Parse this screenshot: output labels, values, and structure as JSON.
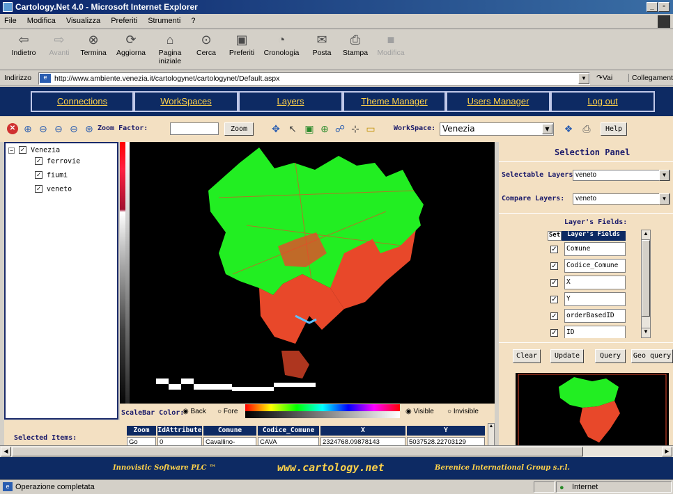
{
  "window": {
    "title": "Cartology.Net 4.0 - Microsoft Internet Explorer"
  },
  "menu": [
    "File",
    "Modifica",
    "Visualizza",
    "Preferiti",
    "Strumenti",
    "?"
  ],
  "toolbar": {
    "back": "Indietro",
    "forward": "Avanti",
    "stop": "Termina",
    "refresh": "Aggiorna",
    "home_line1": "Pagina",
    "home_line2": "iniziale",
    "search": "Cerca",
    "favorites": "Preferiti",
    "history": "Cronologia",
    "mail": "Posta",
    "print": "Stampa",
    "edit": "Modifica"
  },
  "address": {
    "label": "Indirizzo",
    "url": "http://www.ambiente.venezia.it/cartologynet/cartologynet/Default.aspx",
    "go": "Vai",
    "links": "Collegamenti"
  },
  "nav": [
    "Connections",
    "WorkSpaces",
    "Layers",
    "Theme Manager",
    "Users Manager",
    "Log out"
  ],
  "tools": {
    "zoom_factor_label": "Zoom Factor:",
    "zoom_factor_value": "",
    "zoom_button": "Zoom",
    "workspace_label": "WorkSpace:",
    "workspace_value": "Venezia",
    "help_button": "Help"
  },
  "tree": {
    "root": "Venezia",
    "layers": [
      "ferrovie",
      "fiumi",
      "veneto"
    ]
  },
  "selection_panel": {
    "title": "Selection Panel",
    "selectable_label": "Selectable Layers:",
    "selectable_value": "veneto",
    "compare_label": "Compare Layers:",
    "compare_value": "veneto",
    "fields_title": "Layer's Fields:",
    "col_set": "Set",
    "col_fields": "Layer's Fields",
    "fields": [
      "Comune",
      "Codice_Comune",
      "X",
      "Y",
      "orderBasedID",
      "ID"
    ],
    "buttons": [
      "Clear",
      "Update",
      "Query",
      "Geo query"
    ]
  },
  "scalebar": {
    "label": "ScaleBar Color:",
    "back": "Back",
    "fore": "Fore",
    "visible": "Visible",
    "invisible": "Invisible"
  },
  "selected_items": {
    "label": "Selected Items:",
    "headers": [
      "Zoom",
      "IdAttribute",
      "Comune",
      "Codice_Comune",
      "X",
      "Y"
    ],
    "row": [
      "Go",
      "0",
      "Cavallino-",
      "CAVA",
      "2324768.09878143",
      "5037528.22703129"
    ]
  },
  "footer": {
    "left": "Innovistic Software PLC ™",
    "center": "www.cartology.net",
    "right": "Berenice International Group s.r.l."
  },
  "status": {
    "text": "Operazione completata",
    "zone": "Internet"
  },
  "colors": {
    "nav_bg": "#0d2a63",
    "nav_text": "#ffd24a",
    "panel_bg": "#f3e0c2",
    "land": "#22ee22",
    "urban": "#e8482a"
  }
}
